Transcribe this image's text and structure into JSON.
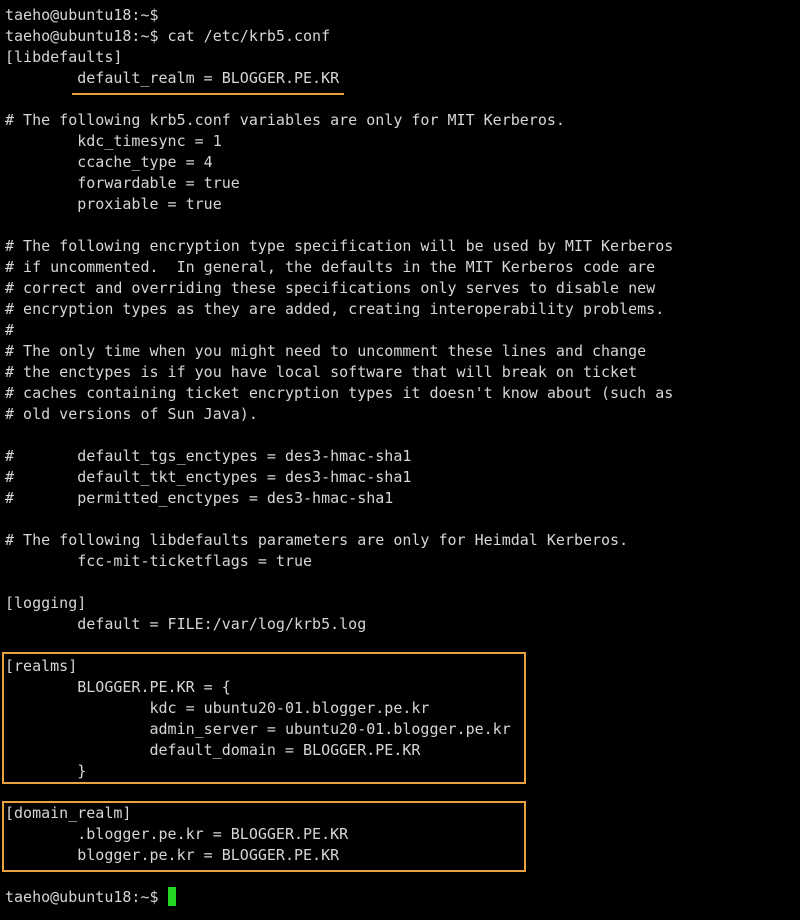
{
  "terminal": {
    "lines": [
      "taeho@ubuntu18:~$",
      "taeho@ubuntu18:~$ cat /etc/krb5.conf",
      "[libdefaults]",
      "        default_realm = BLOGGER.PE.KR",
      "",
      "# The following krb5.conf variables are only for MIT Kerberos.",
      "        kdc_timesync = 1",
      "        ccache_type = 4",
      "        forwardable = true",
      "        proxiable = true",
      "",
      "# The following encryption type specification will be used by MIT Kerberos",
      "# if uncommented.  In general, the defaults in the MIT Kerberos code are",
      "# correct and overriding these specifications only serves to disable new",
      "# encryption types as they are added, creating interoperability problems.",
      "#",
      "# The only time when you might need to uncomment these lines and change",
      "# the enctypes is if you have local software that will break on ticket",
      "# caches containing ticket encryption types it doesn't know about (such as",
      "# old versions of Sun Java).",
      "",
      "#       default_tgs_enctypes = des3-hmac-sha1",
      "#       default_tkt_enctypes = des3-hmac-sha1",
      "#       permitted_enctypes = des3-hmac-sha1",
      "",
      "# The following libdefaults parameters are only for Heimdal Kerberos.",
      "        fcc-mit-ticketflags = true",
      "",
      "[logging]",
      "        default = FILE:/var/log/krb5.log",
      "",
      "[realms]",
      "        BLOGGER.PE.KR = {",
      "                kdc = ubuntu20-01.blogger.pe.kr",
      "                admin_server = ubuntu20-01.blogger.pe.kr",
      "                default_domain = BLOGGER.PE.KR",
      "        }",
      "",
      "[domain_realm]",
      "        .blogger.pe.kr = BLOGGER.PE.KR",
      "        blogger.pe.kr = BLOGGER.PE.KR",
      "",
      "taeho@ubuntu18:~$ "
    ]
  },
  "colors": {
    "background": "#000000",
    "text": "#d6d6d6",
    "highlight": "#e8a33c",
    "cursor": "#22d622"
  }
}
